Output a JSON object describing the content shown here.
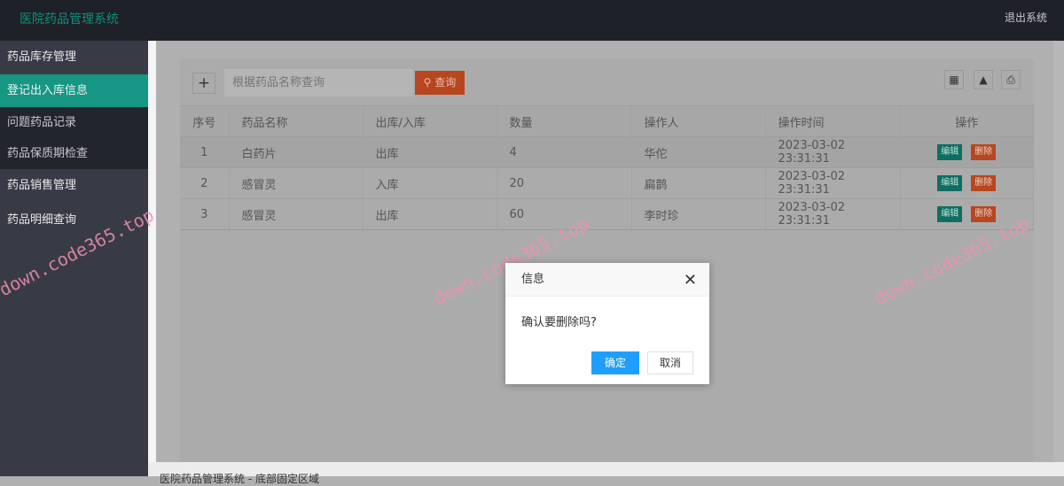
{
  "header": {
    "title": "医院药品管理系统",
    "logout": "退出系统"
  },
  "sidebar": {
    "items": [
      {
        "label": "药品库存管理"
      },
      {
        "label": "登记出入库信息"
      },
      {
        "label": "问题药品记录"
      },
      {
        "label": "药品保质期检查"
      },
      {
        "label": "药品销售管理"
      },
      {
        "label": "药品明细查询"
      }
    ]
  },
  "toolbar": {
    "add": "+",
    "search_placeholder": "根据药品名称查询",
    "search_btn": "查询"
  },
  "table": {
    "headers": [
      "序号",
      "药品名称",
      "出库/入库",
      "数量",
      "操作人",
      "操作时间",
      "操作"
    ],
    "rows": [
      {
        "id": "1",
        "name": "白药片",
        "type": "出库",
        "qty": "4",
        "operator": "华佗",
        "time": "2023-03-02 23:31:31"
      },
      {
        "id": "2",
        "name": "感冒灵",
        "type": "入库",
        "qty": "20",
        "operator": "扁鹊",
        "time": "2023-03-02 23:31:31"
      },
      {
        "id": "3",
        "name": "感冒灵",
        "type": "出库",
        "qty": "60",
        "operator": "李时珍",
        "time": "2023-03-02 23:31:31"
      }
    ],
    "edit": "编辑",
    "delete": "删除"
  },
  "dialog": {
    "title": "信息",
    "message": "确认要删除吗?",
    "ok": "确定",
    "cancel": "取消"
  },
  "footer": {
    "text": "医院药品管理系统 - 底部固定区域"
  },
  "watermark": "down.code365.top"
}
